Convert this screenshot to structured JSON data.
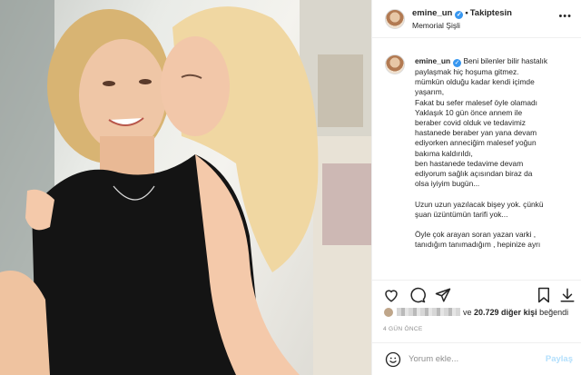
{
  "post": {
    "username": "emine_un",
    "follow_label": "Takiptesin",
    "location": "Memorial Şişli",
    "more_label": "•••"
  },
  "caption": {
    "username": "emine_un",
    "lines": [
      "Beni bilenler bilir hastalık",
      "paylaşmak hiç hoşuma gitmez.",
      "mümkün olduğu kadar kendi içimde",
      "yaşarım,",
      "Fakat bu sefer malesef öyle olamadı",
      "Yaklaşık 10 gün önce annem ile",
      "beraber covid olduk ve tedavimiz",
      "hastanede beraber yan yana devam",
      "ediyorken anneciğim malesef yoğun",
      "bakıma kaldırıldı,",
      "ben hastanede tedavime devam",
      "ediyorum sağlık açısından biraz da",
      "olsa iyiyim bugün...",
      "",
      "Uzun uzun yazılacak bişey yok. çünkü",
      "şuan üzüntümün tarifi yok...",
      "",
      "Öyle çok arayan soran yazan varki ,",
      "tanıdığım tanımadığım , hepinize ayrı"
    ]
  },
  "likes": {
    "prefix": "ve",
    "count": "20.729 diğer kişi",
    "suffix": "beğendi"
  },
  "timestamp": "4 GÜN ÖNCE",
  "comment": {
    "placeholder": "Yorum ekle...",
    "post_label": "Paylaş"
  },
  "colors": {
    "verified": "#3897f0",
    "post_disabled": "#b2dffc",
    "muted": "#8e8e8e"
  },
  "icons": [
    "heart-icon",
    "comment-icon",
    "share-icon",
    "bookmark-icon",
    "download-icon",
    "smiley-icon",
    "verified-badge-icon"
  ]
}
